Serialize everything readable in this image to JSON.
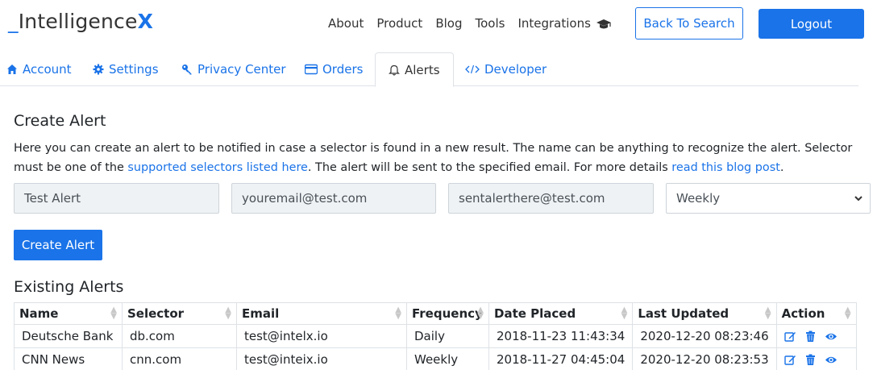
{
  "brand": {
    "underscore": "_",
    "name": "Intelligence",
    "x": "X"
  },
  "topnav": [
    "About",
    "Product",
    "Blog",
    "Tools",
    "Integrations"
  ],
  "buttons": {
    "back": "Back To Search",
    "logout": "Logout",
    "create": "Create Alert"
  },
  "tabs": [
    {
      "label": "Account",
      "icon": "home-icon"
    },
    {
      "label": "Settings",
      "icon": "gear-icon"
    },
    {
      "label": "Privacy Center",
      "icon": "key-icon"
    },
    {
      "label": "Orders",
      "icon": "credit-card-icon"
    },
    {
      "label": "Alerts",
      "icon": "bell-icon",
      "active": true
    },
    {
      "label": "Developer",
      "icon": "code-icon"
    }
  ],
  "create": {
    "heading": "Create Alert",
    "desc_1": "Here you can create an alert to be notified in case a selector is found in a new result. The name can be anything to recognize the alert. Selector must be one of the ",
    "link_1": "supported selectors listed here",
    "desc_2": ". The alert will be sent to the specified email. For more details ",
    "link_2": "read this blog post",
    "desc_3": ".",
    "name_value": "Test Alert",
    "email_value": "youremail@test.com",
    "send_to_value": "sentalerthere@test.com",
    "frequency_value": "Weekly"
  },
  "existing": {
    "heading": "Existing Alerts",
    "columns": [
      "Name",
      "Selector",
      "Email",
      "Frequency",
      "Date Placed",
      "Last Updated",
      "Action"
    ],
    "rows": [
      [
        "Deutsche Bank",
        "db.com",
        "test@intelx.io",
        "Daily",
        "2018-11-23 11:43:34",
        "2020-12-20 08:23:46"
      ],
      [
        "CNN News",
        "cnn.com",
        "test@inteix.io",
        "Weekly",
        "2018-11-27 04:45:04",
        "2020-12-20 08:23:53"
      ]
    ]
  },
  "colors": {
    "accent": "#1a73e8"
  }
}
